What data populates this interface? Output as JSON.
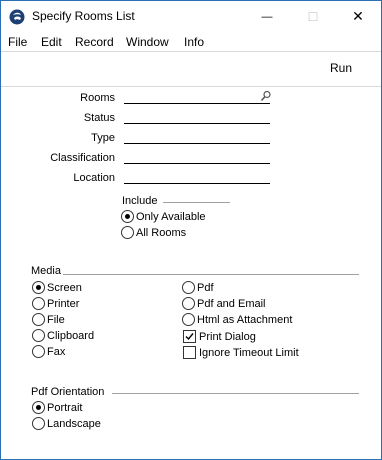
{
  "window": {
    "title": "Specify Rooms List",
    "minimize_glyph": "—",
    "maximize_glyph": "☐",
    "close_glyph": "✕"
  },
  "menu": {
    "items": [
      "File",
      "Edit",
      "Record",
      "Window",
      "Info"
    ]
  },
  "toolbar": {
    "run_label": "Run"
  },
  "fields": {
    "rooms": {
      "label": "Rooms",
      "value": ""
    },
    "status": {
      "label": "Status",
      "value": ""
    },
    "type": {
      "label": "Type",
      "value": ""
    },
    "classification": {
      "label": "Classification",
      "value": ""
    },
    "location": {
      "label": "Location",
      "value": ""
    }
  },
  "include": {
    "title": "Include",
    "options": [
      "Only Available",
      "All Rooms"
    ],
    "selected": "Only Available"
  },
  "media": {
    "title": "Media",
    "options_left": [
      "Screen",
      "Printer",
      "File",
      "Clipboard",
      "Fax"
    ],
    "options_right": [
      "Pdf",
      "Pdf and Email",
      "Html as Attachment"
    ],
    "selected": "Screen",
    "checkboxes": [
      {
        "label": "Print Dialog",
        "checked": true
      },
      {
        "label": "Ignore Timeout Limit",
        "checked": false
      }
    ]
  },
  "pdf_orientation": {
    "title": "Pdf Orientation",
    "options": [
      "Portrait",
      "Landscape"
    ],
    "selected": "Portrait"
  },
  "icons": {
    "app": "app-logo-icon",
    "paste": "paste-special-icon"
  },
  "colors": {
    "window_border": "#2b6fb4",
    "divider": "#d9d9d9",
    "group_rule": "#a0a0a0"
  }
}
